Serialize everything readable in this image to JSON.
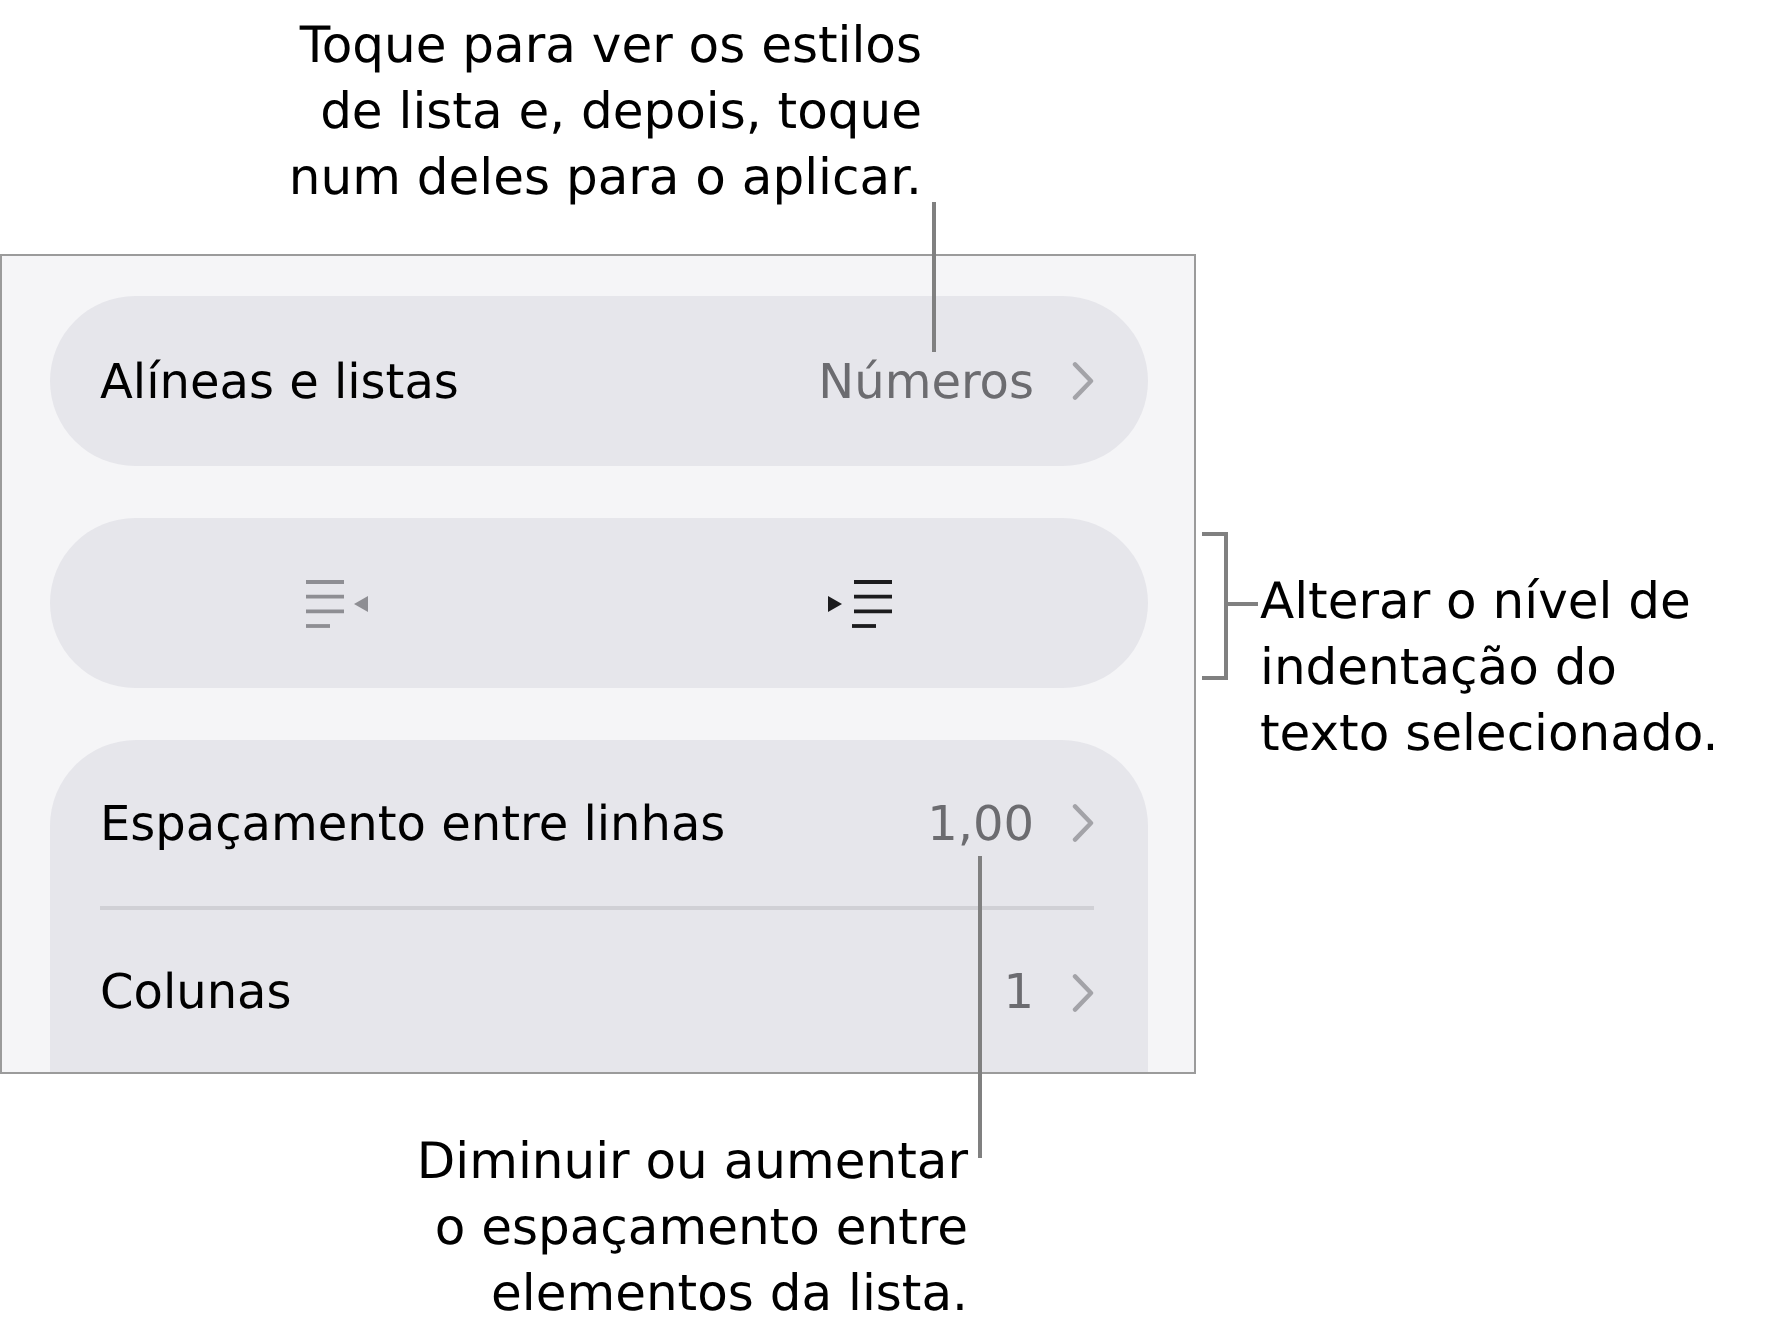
{
  "callouts": [
    {
      "lines": [
        "Toque para ver os estilos",
        "de lista e, depois, toque",
        "num deles para o aplicar."
      ]
    },
    {
      "lines": [
        "Alterar o nível de",
        "indentação do",
        "texto selecionado."
      ]
    },
    {
      "lines": [
        "Diminuir ou aumentar",
        "o espaçamento entre",
        "elementos da lista."
      ]
    }
  ],
  "panel": {
    "sections": [
      {
        "kind": "row",
        "label": "Alíneas e listas",
        "value": "Números"
      },
      {
        "kind": "indent",
        "buttons": [
          {
            "kind": "outdent",
            "disabled": true
          },
          {
            "kind": "indent",
            "disabled": false
          }
        ]
      },
      {
        "kind": "group",
        "rows": [
          {
            "label": "Espaçamento entre linhas",
            "value": "1,00"
          },
          {
            "label": "Colunas",
            "value": "1"
          }
        ]
      }
    ]
  }
}
